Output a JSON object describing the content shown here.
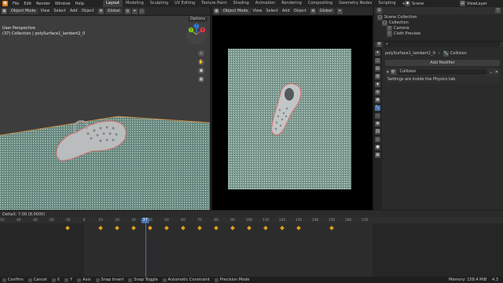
{
  "menu": [
    "File",
    "Edit",
    "Render",
    "Window",
    "Help"
  ],
  "workspaces": [
    {
      "label": "Layout",
      "active": true
    },
    {
      "label": "Modeling",
      "active": false
    },
    {
      "label": "Sculpting",
      "active": false
    },
    {
      "label": "UV Editing",
      "active": false
    },
    {
      "label": "Texture Paint",
      "active": false
    },
    {
      "label": "Shading",
      "active": false
    },
    {
      "label": "Animation",
      "active": false
    },
    {
      "label": "Rendering",
      "active": false
    },
    {
      "label": "Compositing",
      "active": false
    },
    {
      "label": "Geometry Nodes",
      "active": false
    },
    {
      "label": "Scripting",
      "active": false
    }
  ],
  "add_workspace": "+",
  "scene": "Scene",
  "view_layer": "ViewLayer",
  "viewport_left": {
    "mode": "Object Mode",
    "menus": [
      "View",
      "Select",
      "Add",
      "Object"
    ],
    "transform": "Global",
    "view_name": "User Perspective",
    "collection_info": "(37) Collection | polySurface1_lambert2_0",
    "options": "Options",
    "axis_x": "X",
    "axis_y": "Y",
    "axis_z": "Z"
  },
  "viewport_right": {
    "mode": "Object Mode",
    "menus": [
      "View",
      "Select",
      "Add",
      "Object"
    ],
    "transform": "Global"
  },
  "outliner": {
    "items": [
      {
        "label": "Scene Collection",
        "level": 0
      },
      {
        "label": "Collection",
        "level": 1
      },
      {
        "label": "Camera",
        "level": 2
      },
      {
        "label": "Cloth Preview",
        "level": 2
      }
    ]
  },
  "properties": {
    "object_name": "polySurface1_lambert2_0",
    "tab_name": "Collision",
    "add_modifier": "Add Modifier",
    "modifier_name": "Collision",
    "note": "Settings are inside the Physics tab"
  },
  "timeline": {
    "delta": "DeltaX: 7.00 (8.0000)",
    "ticks": [
      "-60",
      "-50",
      "-40",
      "-30",
      "-20",
      "-10",
      "0",
      "10",
      "20",
      "30",
      "40",
      "50",
      "60",
      "70",
      "80",
      "90",
      "100",
      "110",
      "120",
      "130",
      "140",
      "150",
      "160",
      "170"
    ],
    "current_frame": "37",
    "keyframes": [
      -10,
      10,
      20,
      30,
      40,
      50,
      60,
      70,
      80,
      90,
      100,
      110,
      120,
      130,
      150
    ]
  },
  "statusbar": {
    "items": [
      "Confirm",
      "Cancel",
      "X",
      "Y",
      "Axis",
      "Snap Invert",
      "Snap Toggle",
      "Automatic Constraint",
      "Precision Mode"
    ],
    "memory": "Memory: 158.4 MiB",
    "version": "4.3"
  },
  "colors": {
    "accent": "#4772b3",
    "keyframe": "#e0a020",
    "playhead": "#4772b3"
  }
}
